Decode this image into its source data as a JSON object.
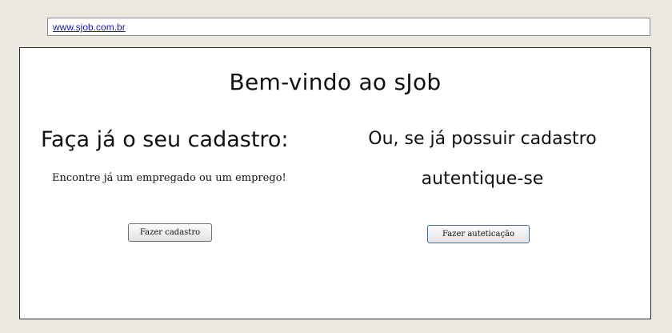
{
  "url_bar": {
    "link_text": "www.sjob.com.br"
  },
  "welcome_title": "Bem-vindo ao sJob",
  "signup": {
    "heading": "Faça já o seu cadastro:",
    "subtext": "Encontre já um empregado ou um emprego!",
    "button_label": "Fazer cadastro"
  },
  "auth": {
    "heading_line1": "Ou, se já possuir cadastro",
    "heading_line2": "autentique-se",
    "button_label": "Fazer auteticação"
  }
}
